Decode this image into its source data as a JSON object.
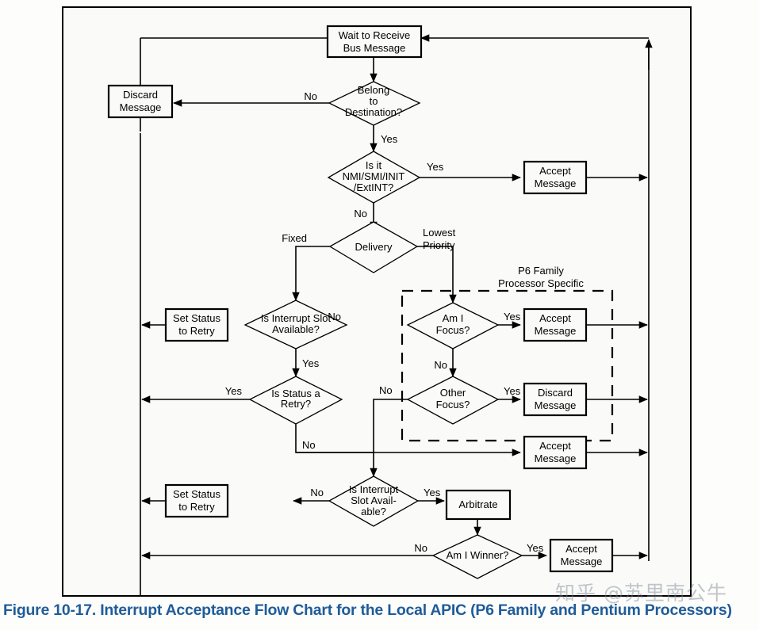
{
  "figure": {
    "caption": "Figure 10-17.  Interrupt Acceptance Flow Chart for the Local APIC (P6 Family and Pentium Processors)",
    "caption_color": "#1f5c99",
    "watermark": "知乎 @苏里南公牛"
  },
  "group": {
    "label_line1": "P6 Family",
    "label_line2": "Processor Specific"
  },
  "nodes": {
    "wait_receive": {
      "line1": "Wait to Receive",
      "line2": "Bus Message",
      "type": "process"
    },
    "belong_dest": {
      "line1": "Belong",
      "line2": "to",
      "line3": "Destination?",
      "type": "decision"
    },
    "discard_top": {
      "line1": "Discard",
      "line2": "Message",
      "type": "process"
    },
    "is_nmi": {
      "line1": "Is it",
      "line2": "NMI/SMI/INIT",
      "line3": "/ExtINT?",
      "type": "decision"
    },
    "accept_nmi": {
      "line1": "Accept",
      "line2": "Message",
      "type": "process"
    },
    "delivery": {
      "line1": "Delivery",
      "type": "decision"
    },
    "slot_avail_1": {
      "line1": "Is Interrupt Slot",
      "line2": "Available?",
      "type": "decision"
    },
    "set_retry_1": {
      "line1": "Set Status",
      "line2": "to Retry",
      "type": "process"
    },
    "status_retry": {
      "line1": "Is Status a",
      "line2": "Retry?",
      "type": "decision"
    },
    "am_i_focus": {
      "line1": "Am I",
      "line2": "Focus?",
      "type": "decision"
    },
    "accept_focus": {
      "line1": "Accept",
      "line2": "Message",
      "type": "process"
    },
    "other_focus": {
      "line1": "Other",
      "line2": "Focus?",
      "type": "decision"
    },
    "discard_other": {
      "line1": "Discard",
      "line2": "Message",
      "type": "process"
    },
    "accept_lowest": {
      "line1": "Accept",
      "line2": "Message",
      "type": "process"
    },
    "slot_avail_2": {
      "line1": "Is Interrupt",
      "line2": "Slot Avail-",
      "line3": "able?",
      "type": "decision"
    },
    "set_retry_2": {
      "line1": "Set Status",
      "line2": "to Retry",
      "type": "process"
    },
    "arbitrate": {
      "line1": "Arbitrate",
      "type": "process"
    },
    "am_i_winner": {
      "line1": "Am I Winner?",
      "type": "decision"
    },
    "accept_winner": {
      "line1": "Accept",
      "line2": "Message",
      "type": "process"
    }
  },
  "edge_labels": {
    "belong_no": "No",
    "belong_yes": "Yes",
    "nmi_yes": "Yes",
    "nmi_no": "No",
    "delivery_fixed": "Fixed",
    "delivery_lowest_1": "Lowest",
    "delivery_lowest_2": "Priority",
    "slot1_no": "No",
    "slot1_yes": "Yes",
    "retry_yes": "Yes",
    "retry_no": "No",
    "focus_yes": "Yes",
    "focus_no": "No",
    "other_yes": "Yes",
    "other_no": "No",
    "slot2_no": "No",
    "slot2_yes": "Yes",
    "winner_no": "No",
    "winner_yes": "Yes"
  }
}
